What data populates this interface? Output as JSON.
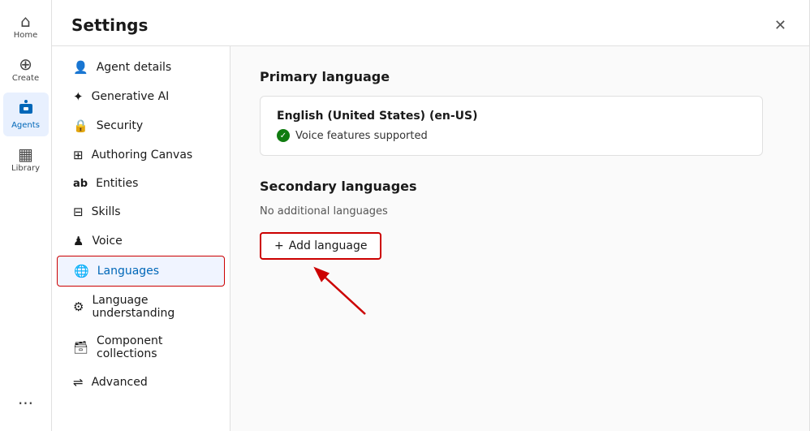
{
  "nav": {
    "items": [
      {
        "id": "home",
        "label": "Home",
        "icon": "⊞",
        "active": false
      },
      {
        "id": "create",
        "label": "Create",
        "icon": "⊕",
        "active": false
      },
      {
        "id": "agents",
        "label": "Agents",
        "icon": "●",
        "active": true
      },
      {
        "id": "library",
        "label": "Library",
        "icon": "⊟",
        "active": false
      },
      {
        "id": "more",
        "label": "...",
        "icon": "···",
        "active": false
      }
    ]
  },
  "settings": {
    "title": "Settings",
    "close_label": "✕",
    "menu_items": [
      {
        "id": "agent-details",
        "label": "Agent details",
        "icon": "👤",
        "active": false
      },
      {
        "id": "generative-ai",
        "label": "Generative AI",
        "icon": "✦",
        "active": false
      },
      {
        "id": "security",
        "label": "Security",
        "icon": "🔒",
        "active": false
      },
      {
        "id": "authoring-canvas",
        "label": "Authoring Canvas",
        "icon": "⊞",
        "active": false
      },
      {
        "id": "entities",
        "label": "Entities",
        "icon": "ab",
        "active": false
      },
      {
        "id": "skills",
        "label": "Skills",
        "icon": "⊟",
        "active": false
      },
      {
        "id": "voice",
        "label": "Voice",
        "icon": "♟",
        "active": false
      },
      {
        "id": "languages",
        "label": "Languages",
        "icon": "🌐",
        "active": true
      },
      {
        "id": "language-understanding",
        "label": "Language understanding",
        "icon": "⚙",
        "active": false
      },
      {
        "id": "component-collections",
        "label": "Component collections",
        "icon": "🗃",
        "active": false
      },
      {
        "id": "advanced",
        "label": "Advanced",
        "icon": "⇌",
        "active": false
      }
    ]
  },
  "content": {
    "primary_language_title": "Primary language",
    "primary_language_name": "English (United States) (en-US)",
    "voice_supported_label": "Voice features supported",
    "secondary_languages_title": "Secondary languages",
    "no_languages_label": "No additional languages",
    "add_language_label": "Add language",
    "add_language_plus": "+"
  }
}
